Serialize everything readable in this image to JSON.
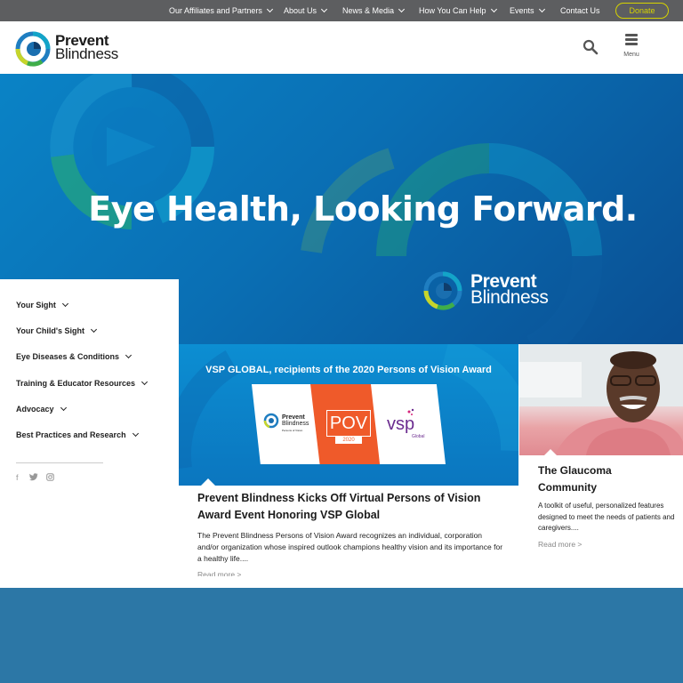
{
  "topnav": {
    "items": [
      {
        "label": "Our Affiliates and Partners",
        "dropdown": true
      },
      {
        "label": "About Us",
        "dropdown": true
      },
      {
        "label": "News & Media",
        "dropdown": true
      },
      {
        "label": "How You Can Help",
        "dropdown": true
      },
      {
        "label": "Events",
        "dropdown": true
      },
      {
        "label": "Contact Us",
        "dropdown": false
      }
    ],
    "donate": "Donate"
  },
  "header": {
    "logo_line1": "Prevent",
    "logo_line2": "Blindness",
    "search_icon": "search-icon",
    "menu_label": "Menu"
  },
  "hero": {
    "title": "Eye Health, Looking Forward.",
    "logo_line1": "Prevent",
    "logo_line2": "Blindness"
  },
  "sidebar": {
    "items": [
      {
        "label": "Your Sight"
      },
      {
        "label": "Your Child's Sight"
      },
      {
        "label": "Eye Diseases & Conditions"
      },
      {
        "label": "Training & Educator Resources"
      },
      {
        "label": "Advocacy"
      },
      {
        "label": "Best Practices and Research"
      }
    ],
    "social": [
      "f",
      "twitter-icon",
      "instagram-icon"
    ]
  },
  "feature": {
    "image_caption": "VSP GLOBAL, recipients of the 2020 Persons of Vision Award",
    "panel_logo_line1": "Prevent",
    "panel_logo_line2": "Blindness",
    "panel_logo_line3": "Persons of Vision",
    "pov": "POV",
    "pov_year": "2020",
    "vsp": "vsp",
    "vsp_sub": "Global",
    "title": "Prevent Blindness Kicks Off Virtual Persons of Vision Award Event Honoring VSP Global",
    "body": "The Prevent Blindness Persons of Vision Award recognizes an individual, corporation and/or organization whose inspired outlook champions healthy vision and its importance for a healthy life....",
    "more": "Read more >"
  },
  "side_card": {
    "title": "The Glaucoma Community",
    "body": "A toolkit of useful, personalized features designed to meet the needs of patients and caregivers....",
    "more": "Read more >"
  },
  "colors": {
    "topbar": "#5d5e60",
    "accent_yellow": "#d6d300",
    "hero_blue": "#0a6fb4",
    "pov_orange": "#ef5a2a",
    "footer_blue": "#2c77a6"
  }
}
